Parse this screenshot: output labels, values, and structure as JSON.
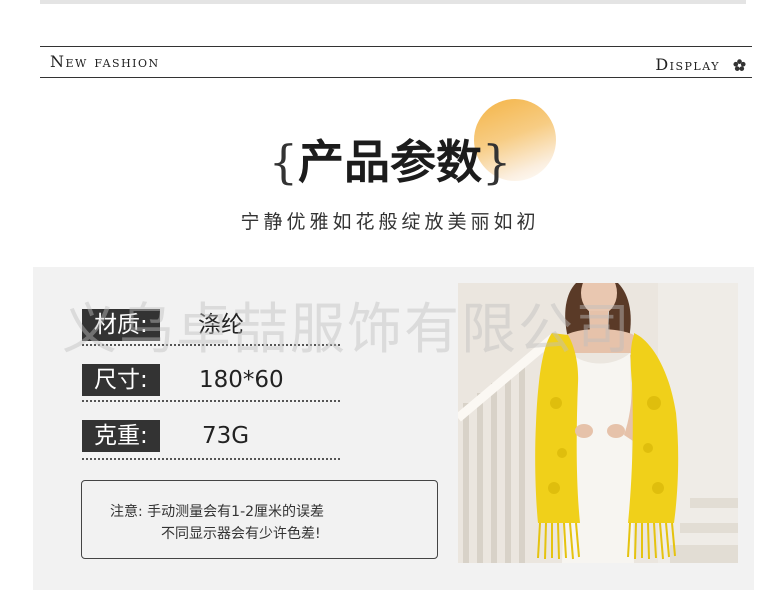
{
  "banner": {
    "left_text": "New fashion",
    "right_text": "Display",
    "icon": "flower-icon"
  },
  "header": {
    "brace_open": "{",
    "title": "产品参数",
    "brace_close": "}",
    "subtitle": "宁静优雅如花般绽放美丽如初"
  },
  "specs": [
    {
      "label": "材质:",
      "value": "涤纶"
    },
    {
      "label": "尺寸:",
      "value": "180*60"
    },
    {
      "label": "克重:",
      "value": "73G"
    }
  ],
  "note": {
    "line1": "注意:  手动测量会有1-2厘米的误差",
    "line2": "不同显示器会有少许色差!"
  },
  "watermark": "义乌卓喆服饰有限公司",
  "colors": {
    "accent": "#f4b446",
    "label_bg": "#333333",
    "panel_bg": "#f2f2f2",
    "scarf": "#f0d01a"
  }
}
